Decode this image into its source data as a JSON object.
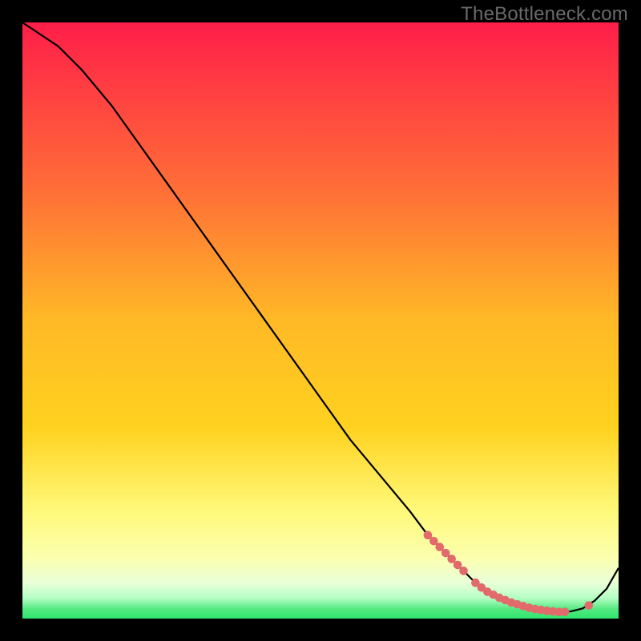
{
  "watermark": "TheBottleneck.com",
  "colors": {
    "bg": "#000000",
    "gradient_top": "#ff1e49",
    "gradient_mid_upper": "#ff8a2a",
    "gradient_mid": "#ffd21f",
    "gradient_mid_lower": "#fff55a",
    "gradient_lower": "#fbffb0",
    "gradient_band_pale": "#e9ffd9",
    "gradient_green": "#2ee66e",
    "curve": "#000000",
    "marker": "#e26a6a"
  },
  "chart_data": {
    "type": "line",
    "title": "",
    "xlabel": "",
    "ylabel": "",
    "xlim": [
      0,
      100
    ],
    "ylim": [
      0,
      100
    ],
    "series": [
      {
        "name": "bottleneck-curve",
        "x": [
          0,
          3,
          6,
          10,
          15,
          20,
          25,
          30,
          35,
          40,
          45,
          50,
          55,
          60,
          65,
          68,
          71,
          74,
          76,
          78,
          80,
          82,
          84,
          86,
          88,
          90,
          92,
          94,
          96,
          98,
          100
        ],
        "y": [
          100,
          98,
          96,
          92,
          86,
          79,
          72,
          65,
          58,
          51,
          44,
          37,
          30,
          24,
          18,
          14,
          11,
          8,
          6,
          4.5,
          3.5,
          2.7,
          2.1,
          1.6,
          1.3,
          1.1,
          1.2,
          1.7,
          3.0,
          5.0,
          8.5
        ]
      }
    ],
    "markers": {
      "name": "highlighted-points",
      "x": [
        68,
        69,
        70,
        71,
        72,
        73,
        74,
        76,
        77,
        78,
        79,
        80,
        81,
        82,
        83,
        84,
        85,
        86,
        87,
        88,
        89,
        90,
        91,
        95
      ],
      "y": [
        14,
        13,
        12,
        11,
        10,
        9,
        8,
        6,
        5.2,
        4.5,
        4.0,
        3.5,
        3.1,
        2.7,
        2.4,
        2.1,
        1.8,
        1.6,
        1.45,
        1.3,
        1.2,
        1.1,
        1.12,
        2.2
      ]
    }
  }
}
